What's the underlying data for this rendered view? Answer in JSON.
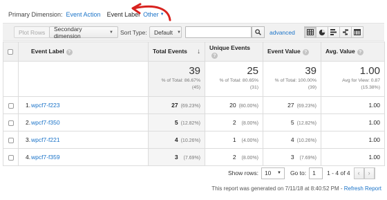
{
  "dimension": {
    "label": "Primary Dimension:",
    "options": [
      "Event Action",
      "Event Label",
      "Other"
    ],
    "selected": "Event Label"
  },
  "toolbar": {
    "plot_rows": "Plot Rows",
    "secondary_dimension": "Secondary dimension",
    "sort_type_label": "Sort Type:",
    "sort_type_value": "Default",
    "search_value": "",
    "advanced": "advanced"
  },
  "table": {
    "headers": {
      "event_label": "Event Label",
      "total_events": "Total Events",
      "unique_events": "Unique Events",
      "event_value": "Event Value",
      "avg_value": "Avg. Value"
    },
    "totals": {
      "total_events": {
        "value": "39",
        "line1": "% of Total: 86.67%",
        "line2": "(45)"
      },
      "unique_events": {
        "value": "25",
        "line1": "% of Total: 80.65%",
        "line2": "(31)"
      },
      "event_value": {
        "value": "39",
        "line1": "% of Total: 100.00%",
        "line2": "(39)"
      },
      "avg_value": {
        "value": "1.00",
        "line1": "Avg for View: 0.87",
        "line2": "(15.38%)"
      }
    },
    "rows": [
      {
        "rank": "1.",
        "label": "wpcf7-f223",
        "total": "27",
        "total_pct": "(69.23%)",
        "unique": "20",
        "unique_pct": "(80.00%)",
        "value": "27",
        "value_pct": "(69.23%)",
        "avg": "1.00"
      },
      {
        "rank": "2.",
        "label": "wpcf7-f350",
        "total": "5",
        "total_pct": "(12.82%)",
        "unique": "2",
        "unique_pct": "(8.00%)",
        "value": "5",
        "value_pct": "(12.82%)",
        "avg": "1.00"
      },
      {
        "rank": "3.",
        "label": "wpcf7-f221",
        "total": "4",
        "total_pct": "(10.26%)",
        "unique": "1",
        "unique_pct": "(4.00%)",
        "value": "4",
        "value_pct": "(10.26%)",
        "avg": "1.00"
      },
      {
        "rank": "4.",
        "label": "wpcf7-f359",
        "total": "3",
        "total_pct": "(7.69%)",
        "unique": "2",
        "unique_pct": "(8.00%)",
        "value": "3",
        "value_pct": "(7.69%)",
        "avg": "1.00"
      }
    ]
  },
  "footer": {
    "show_rows_label": "Show rows:",
    "show_rows_value": "10",
    "goto_label": "Go to:",
    "goto_value": "1",
    "range": "1 - 4 of 4",
    "generated_text": "This report was generated on 7/11/18 at 8:40:52 PM - ",
    "refresh": "Refresh Report"
  },
  "colors": {
    "link": "#1a73c8",
    "annotation_arrow": "#d8231f",
    "header_bg": "#f1f1f1"
  }
}
